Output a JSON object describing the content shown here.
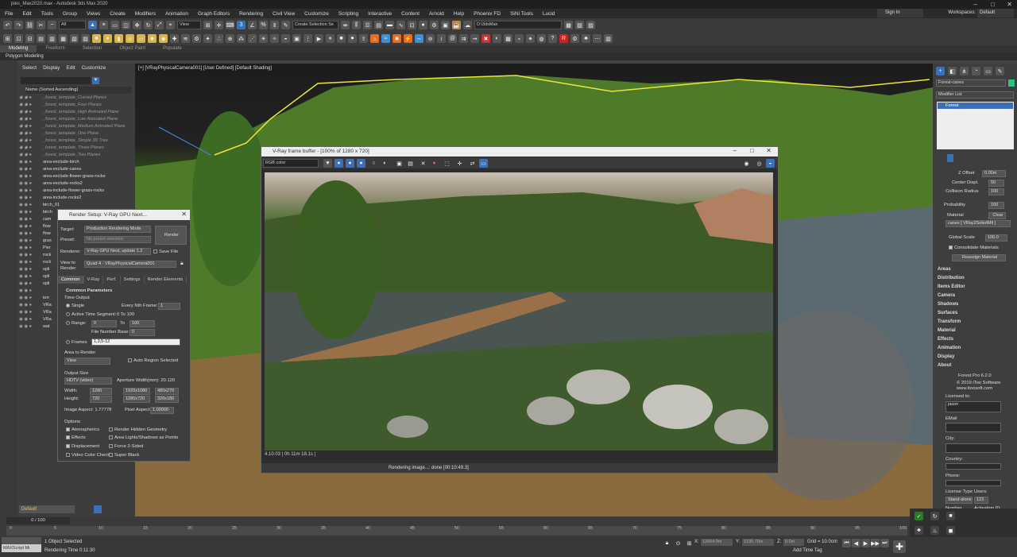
{
  "window": {
    "title": "pies_Max2020.max - Autodesk 3ds Max 2020",
    "sign_in": "Sign In",
    "workspaces_label": "Workspaces:",
    "workspaces_value": "Default"
  },
  "menu": [
    "File",
    "Edit",
    "Tools",
    "Group",
    "Views",
    "Create",
    "Modifiers",
    "Animation",
    "Graph Editors",
    "Rendering",
    "Civil View",
    "Customize",
    "Scripting",
    "Interactive",
    "Content",
    "Arnold",
    "Help",
    "Phoenix FD",
    "SiNi Tools",
    "Lucid"
  ],
  "toolbar": {
    "filter": "All",
    "ref_coord": "View",
    "selection_set": "Create Selection Se",
    "project_path": "D:\\3dsMax"
  },
  "ribbon": {
    "tabs": [
      "Modeling",
      "Freeform",
      "Selection",
      "Object Paint",
      "Populate"
    ],
    "active": "Modeling",
    "sub_label": "Polygon Modeling"
  },
  "scene_explorer": {
    "menu": [
      "Select",
      "Display",
      "Edit",
      "Customize"
    ],
    "header": "Name (Sorted Ascending)",
    "layer": "Default",
    "rows": [
      {
        "name": "_forest_template_Curved Planes",
        "disabled": true
      },
      {
        "name": "_forest_template_Four Planes",
        "disabled": true
      },
      {
        "name": "_forest_template_High Animated Plane",
        "disabled": true
      },
      {
        "name": "_forest_template_Low Animated Plane",
        "disabled": true
      },
      {
        "name": "_forest_template_Medium Animated Plane",
        "disabled": true
      },
      {
        "name": "_forest_template_One Plane",
        "disabled": true
      },
      {
        "name": "_forest_template_Simple 3D Tree",
        "disabled": true
      },
      {
        "name": "_forest_template_Three Planes",
        "disabled": true
      },
      {
        "name": "_forest_template_Two Planes",
        "disabled": true
      },
      {
        "name": "area-exclude-birch",
        "disabled": false
      },
      {
        "name": "area-exclude-canes",
        "disabled": false
      },
      {
        "name": "area-exclude-flower-grass-rocks",
        "disabled": false
      },
      {
        "name": "area-exclude-rocks2",
        "disabled": false
      },
      {
        "name": "area-include-flower-grass-rocks",
        "disabled": false
      },
      {
        "name": "area-include-rocks2",
        "disabled": false
      },
      {
        "name": "birch_01",
        "disabled": false
      },
      {
        "name": "birch",
        "disabled": false
      },
      {
        "name": "cam",
        "disabled": false
      },
      {
        "name": "flow",
        "disabled": false
      },
      {
        "name": "flow",
        "disabled": false
      },
      {
        "name": "gras",
        "disabled": false
      },
      {
        "name": "Pier",
        "disabled": false
      },
      {
        "name": "rock",
        "disabled": false
      },
      {
        "name": "rock",
        "disabled": false
      },
      {
        "name": "spli",
        "disabled": false
      },
      {
        "name": "spli",
        "disabled": false
      },
      {
        "name": "spli",
        "disabled": false
      },
      {
        "name": "",
        "disabled": false
      },
      {
        "name": "terr",
        "disabled": false
      },
      {
        "name": "VRa",
        "disabled": false
      },
      {
        "name": "VRa",
        "disabled": false
      },
      {
        "name": "VRa",
        "disabled": false
      },
      {
        "name": "wat",
        "disabled": false
      }
    ]
  },
  "viewport": {
    "label": "[+] [VRayPhysicalCamera001] [User Defined] [Default Shading]"
  },
  "vfb": {
    "title": "V-Ray frame buffer - [100% of 1280 x 720]",
    "channel": "RGB color",
    "status": "4.10.03  |  0h 11m 18.1s  |",
    "progress": "Rendering image...: done [00:10:49.3]"
  },
  "render_setup": {
    "title": "Render Setup: V-Ray GPU Next...",
    "target_label": "Target:",
    "target": "Production Rendering Mode",
    "preset_label": "Preset:",
    "preset": "No preset selected",
    "renderer_label": "Renderer:",
    "renderer": "V-Ray GPU Next, update 1.2",
    "save_file": "Save File",
    "view_label": "View to Render:",
    "view": "Quad 4 - VRayPhysicalCamera001",
    "render_button": "Render",
    "tabs": [
      "Common",
      "V-Ray",
      "Perf.",
      "Settings",
      "Render Elements"
    ],
    "rollout": "Common Parameters",
    "time_output": "Time Output",
    "single": "Single",
    "every_nth": "Every Nth Frame:",
    "every_nth_val": "1",
    "active_seg": "Active Time Segment:",
    "active_seg_val": "0 To 100",
    "range": "Range:",
    "range_from": "0",
    "range_to_label": "To",
    "range_to": "100",
    "file_number_base": "File Number Base:",
    "file_number_val": "0",
    "frames": "Frames",
    "frames_val": "1,3,5-12",
    "area": "Area to Render",
    "area_val": "View",
    "auto_region": "Auto Region Selected",
    "output_size": "Output Size",
    "size_preset": "HDTV (video)",
    "aperture": "Aperture Width(mm): 20.120",
    "width_label": "Width:",
    "width": "1280",
    "height_label": "Height:",
    "height": "720",
    "p1": "1920x1080",
    "p2": "480x270",
    "p3": "1280x720",
    "p4": "320x180",
    "image_aspect": "Image Aspect: 1.77778",
    "pixel_aspect": "Pixel Aspect:",
    "pixel_aspect_val": "1.00000",
    "options": "Options",
    "opts": [
      "Atmospherics",
      "Effects",
      "Displacement",
      "Video Color Check"
    ],
    "opts2": [
      "Render Hidden Geometry",
      "Area Lights/Shadows as Points",
      "Force 2-Sided",
      "Super Black"
    ]
  },
  "command_panel": {
    "object_name": "Forest-canes",
    "modifier_list": "Modifier List",
    "modifier": "Forest",
    "z_offset": "Z Offset",
    "z_offset_val": "0.00m",
    "center_displ": "Center Displ.",
    "center_displ_val": "50",
    "collision": "Collision Radius",
    "collision_val": "100",
    "probability": "Probability",
    "probability_val": "100",
    "material": "Material",
    "clear": "Clear",
    "material_val": "canes  [ VRay2SidedMtl ]",
    "global_scale": "Global Scale",
    "global_scale_val": "100.0",
    "consolidate": "Consolidate Materials",
    "reassign": "Reassign Material",
    "sections": [
      "Areas",
      "Distribution",
      "Items Editor",
      "Camera",
      "Shadows",
      "Surfaces",
      "Transform",
      "Material",
      "Effects",
      "Animation",
      "Display",
      "About"
    ],
    "about_product": "Forest Pro 6.2.0",
    "about_copy": "© 2019 iToo Software",
    "about_url": "www.itoosoft.com",
    "licensed_to": "Licensed to:",
    "licensed_val": "jason",
    "email": "EMail",
    "city": "City:",
    "country": "Country:",
    "phone": "Phone:",
    "license_type": "License Type",
    "license_type_val": "Stand-alone",
    "users": "Users:",
    "users_val": "123",
    "number": "Number",
    "activation": "Activation ID"
  },
  "timeline": {
    "frame": "0 / 100",
    "ticks": [
      "0",
      "5",
      "10",
      "15",
      "20",
      "25",
      "30",
      "35",
      "40",
      "45",
      "50",
      "55",
      "60",
      "65",
      "70",
      "75",
      "80",
      "85",
      "90",
      "95",
      "100"
    ]
  },
  "status": {
    "maxscript": "MAXScript Mi",
    "selected": "1 Object Selected",
    "render_time": "Rendering Time  0:11:30",
    "x_label": "X:",
    "x_val": "12604.9m",
    "y_label": "Y:",
    "y_val": "1235.76m",
    "z_label": "Z:",
    "z_val": "0.0m",
    "grid": "Grid = 10.0cm",
    "add_time_tag": "Add Time Tag",
    "auto": "Auto",
    "selected_btn": "Selected",
    "set_k": "Set K.",
    "filters": "Filters..."
  }
}
